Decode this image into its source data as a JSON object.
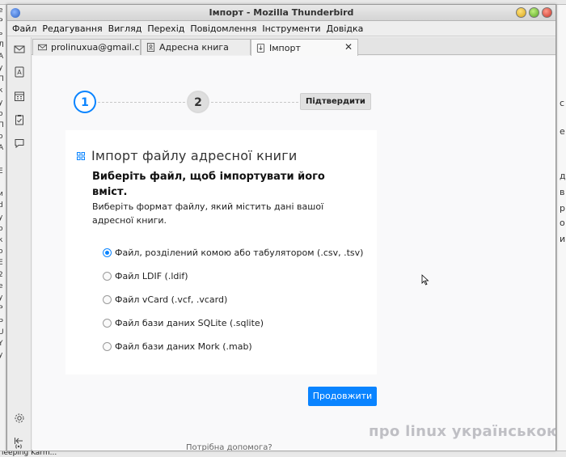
{
  "window": {
    "title": "Імпорт - Mozilla Thunderbird"
  },
  "menubar": {
    "items": [
      "Файл",
      "Редагування",
      "Вигляд",
      "Перехід",
      "Повідомлення",
      "Інструменти",
      "Довідка"
    ]
  },
  "tabs": [
    {
      "label": "prolinuxua@gmail.con",
      "icon": "mail-icon"
    },
    {
      "label": "Адресна книга",
      "icon": "address-book-icon"
    },
    {
      "label": "Імпорт",
      "icon": "import-icon",
      "active": true
    }
  ],
  "stepper": {
    "step1": "1",
    "step2": "2",
    "confirm_label": "Підтвердити"
  },
  "card": {
    "title": "Імпорт файлу адресної книги",
    "subtitle": "Виберіть файл, щоб імпортувати його вміст.",
    "description": "Виберіть формат файлу, який містить дані вашої адресної книги.",
    "options": [
      {
        "label": "Файл, розділений комою або табулятором (.csv, .tsv)",
        "checked": true
      },
      {
        "label": "Файл LDIF (.ldif)",
        "checked": false
      },
      {
        "label": "Файл vCard (.vcf, .vcard)",
        "checked": false
      },
      {
        "label": "Файл бази даних SQLite (.sqlite)",
        "checked": false
      },
      {
        "label": "Файл бази даних Mork (.mab)",
        "checked": false
      }
    ]
  },
  "continue_label": "Продовжити",
  "help_text": "Потрібна допомога?",
  "watermark": "про linux українською",
  "background": {
    "taskbar_label": "leeping Karm..."
  },
  "colors": {
    "accent": "#0a84ff"
  }
}
